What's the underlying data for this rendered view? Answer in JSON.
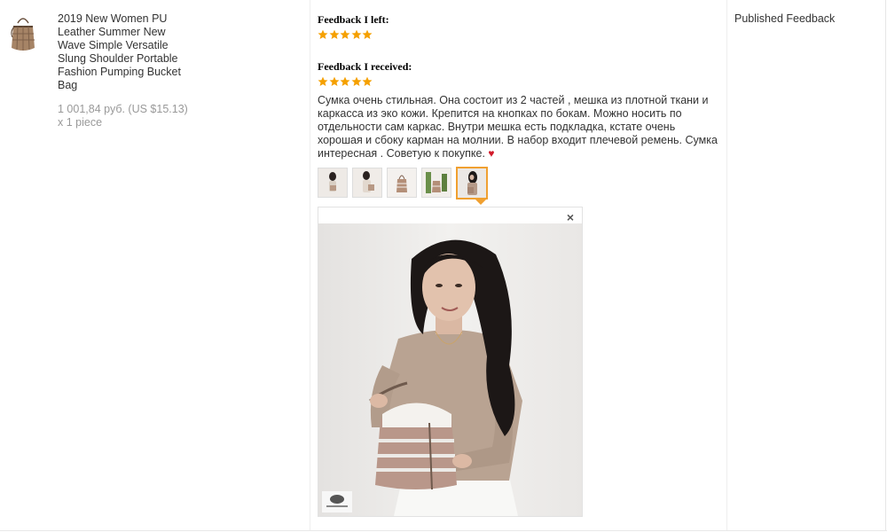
{
  "product": {
    "title": "2019 New Women PU Leather Summer New Wave Simple Versatile Slung Shoulder Portable Fashion Pumping Bucket Bag",
    "price": "1 001,84 руб. (US $15.13)",
    "quantity": "x 1 piece"
  },
  "feedback_left": {
    "heading": "Feedback I left:",
    "rating": 5
  },
  "feedback_received": {
    "heading": "Feedback I received:",
    "rating": 5,
    "text": "Сумка очень стильная. Она состоит из 2 частей , мешка из плотной ткани и каркасса из эко кожи. Крепится на кнопках по бокам. Можно носить по отдельности сам каркас. Внутри мешка есть подкладка, кстате очень хорошая и сбоку карман на молнии. В набор входит плечевой ремень. Сумка интересная . Советую к покупке.",
    "heart": "♥",
    "photos_count": 5,
    "active_photo": 5,
    "close_glyph": "×"
  },
  "status": {
    "label": "Published Feedback"
  },
  "colors": {
    "star": "#f5a000",
    "active_border": "#f0a030",
    "heart": "#d11a2a"
  }
}
